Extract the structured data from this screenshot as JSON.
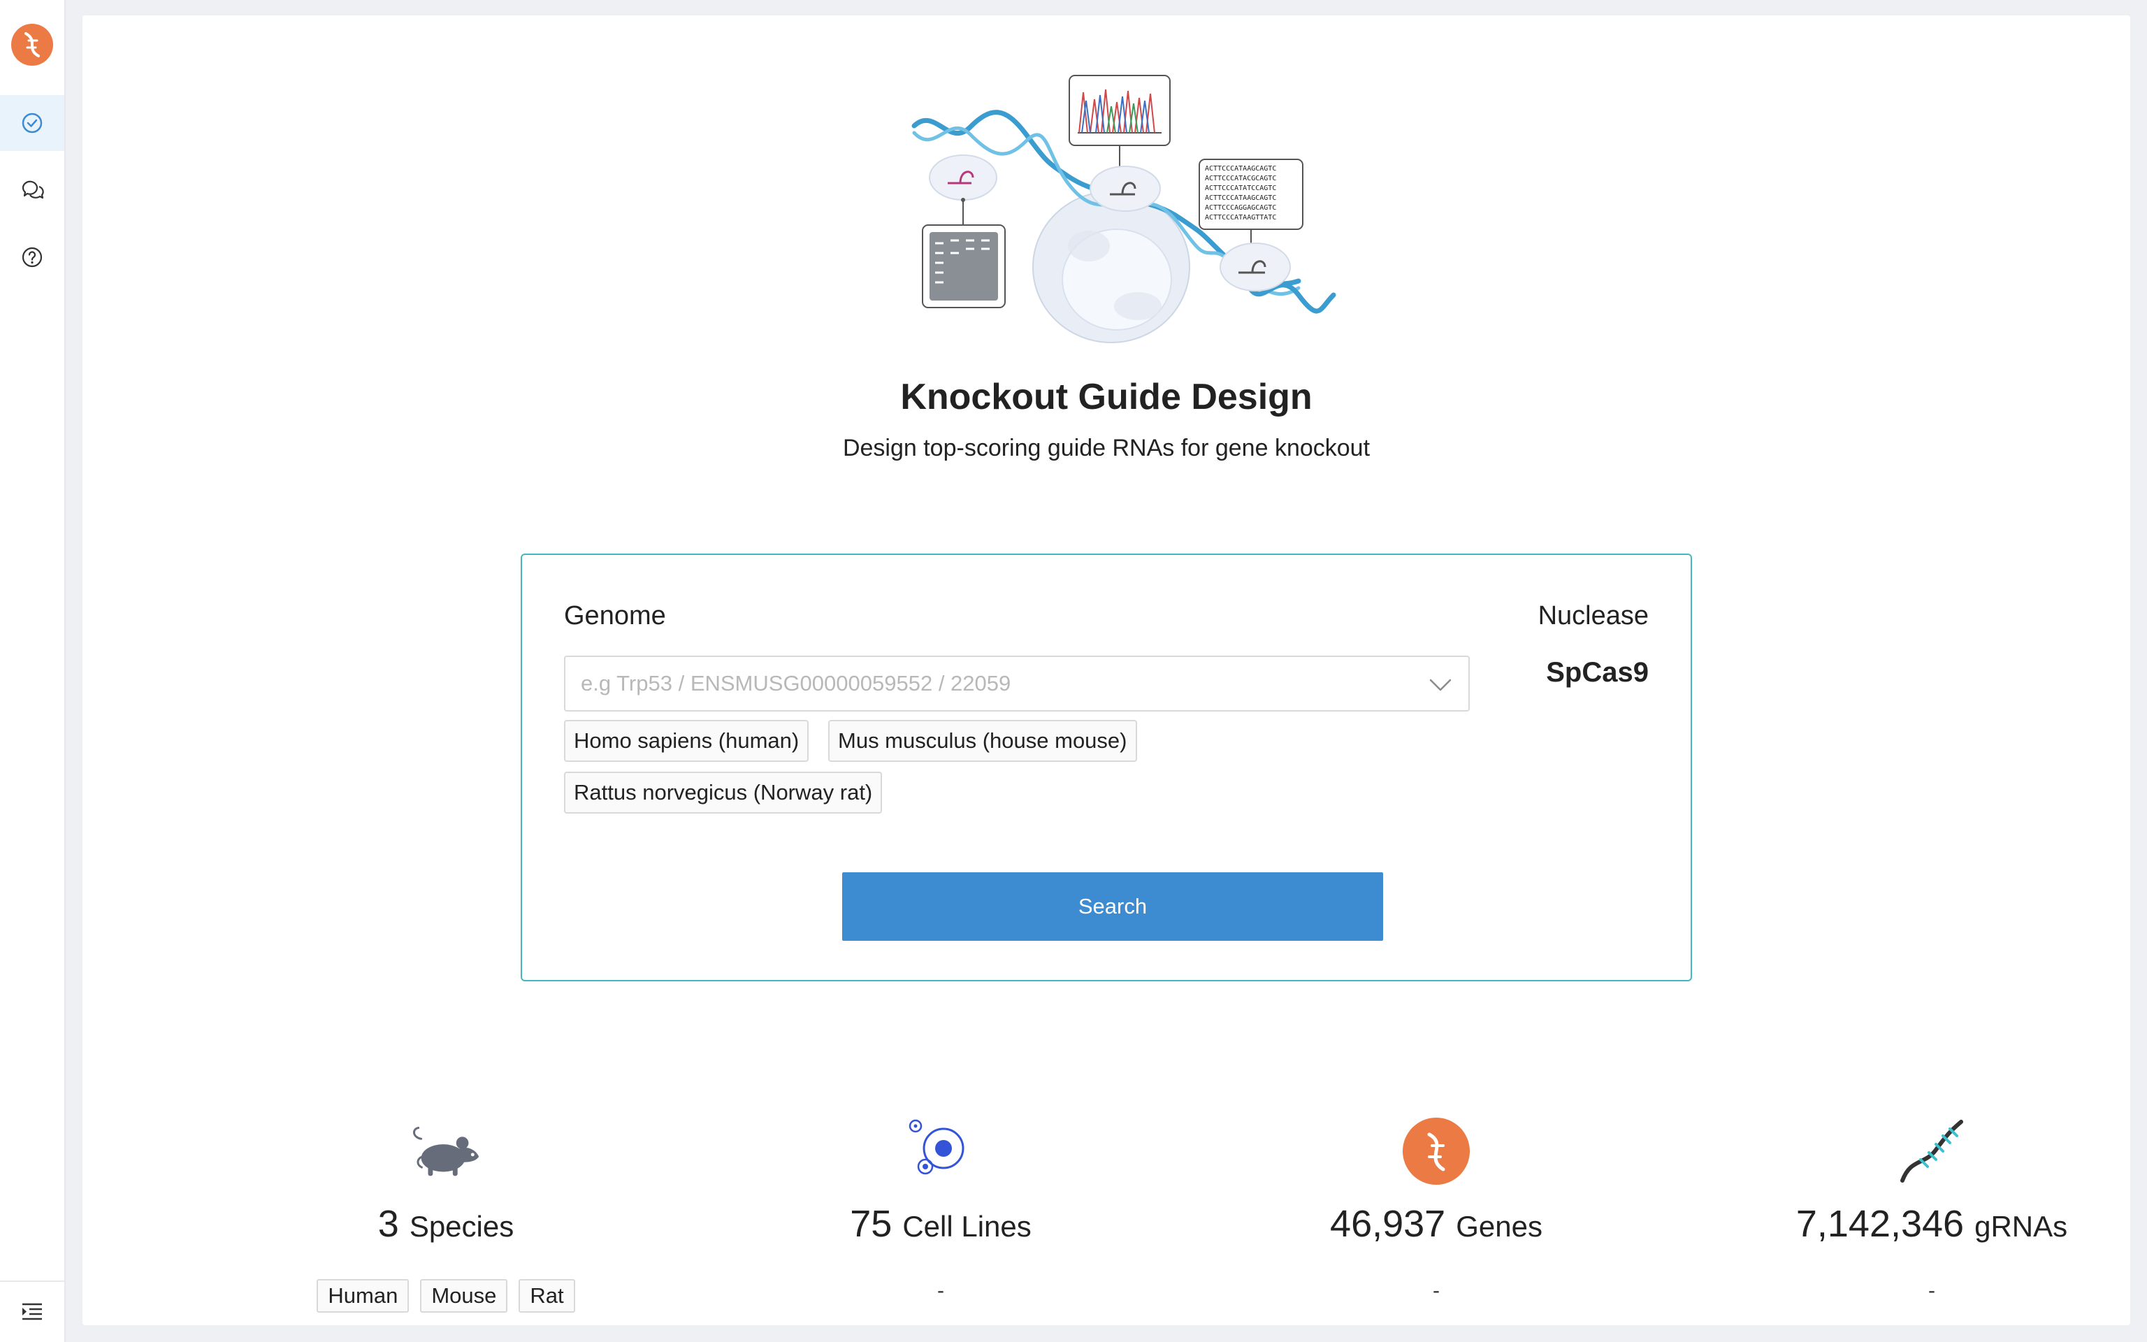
{
  "sidebar": {
    "logo_icon": "dna-helix-logo-icon",
    "items": [
      {
        "icon": "check-circle-icon",
        "active": true
      },
      {
        "icon": "chat-bubbles-icon",
        "active": false
      },
      {
        "icon": "help-circle-icon",
        "active": false
      }
    ],
    "bottom_icon": "menu-indent-icon"
  },
  "page": {
    "title": "Knockout Guide Design",
    "subtitle": "Design top-scoring guide RNAs for gene knockout"
  },
  "form": {
    "genome_label": "Genome",
    "search_placeholder": "e.g Trp53 / ENSMUSG00000059552 / 22059",
    "genome_options": [
      "Homo sapiens (human)",
      "Mus musculus (house mouse)",
      "Rattus norvegicus (Norway rat)"
    ],
    "nuclease_label": "Nuclease",
    "nuclease_value": "SpCas9",
    "search_button": "Search"
  },
  "stats": [
    {
      "icon": "mouse-icon",
      "number": "3",
      "unit": "Species",
      "tags": [
        "Human",
        "Mouse",
        "Rat"
      ],
      "sub": ""
    },
    {
      "icon": "cell-lines-icon",
      "number": "75",
      "unit": "Cell Lines",
      "tags": [],
      "sub": "-"
    },
    {
      "icon": "gene-icon",
      "number": "46,937",
      "unit": "Genes",
      "tags": [],
      "sub": "-"
    },
    {
      "icon": "grna-strand-icon",
      "number": "7,142,346",
      "unit": "gRNAs",
      "tags": [],
      "sub": "-"
    }
  ],
  "colors": {
    "accent_orange": "#ec7a44",
    "primary_blue": "#3d8bd1",
    "card_border": "#46b6bf"
  }
}
